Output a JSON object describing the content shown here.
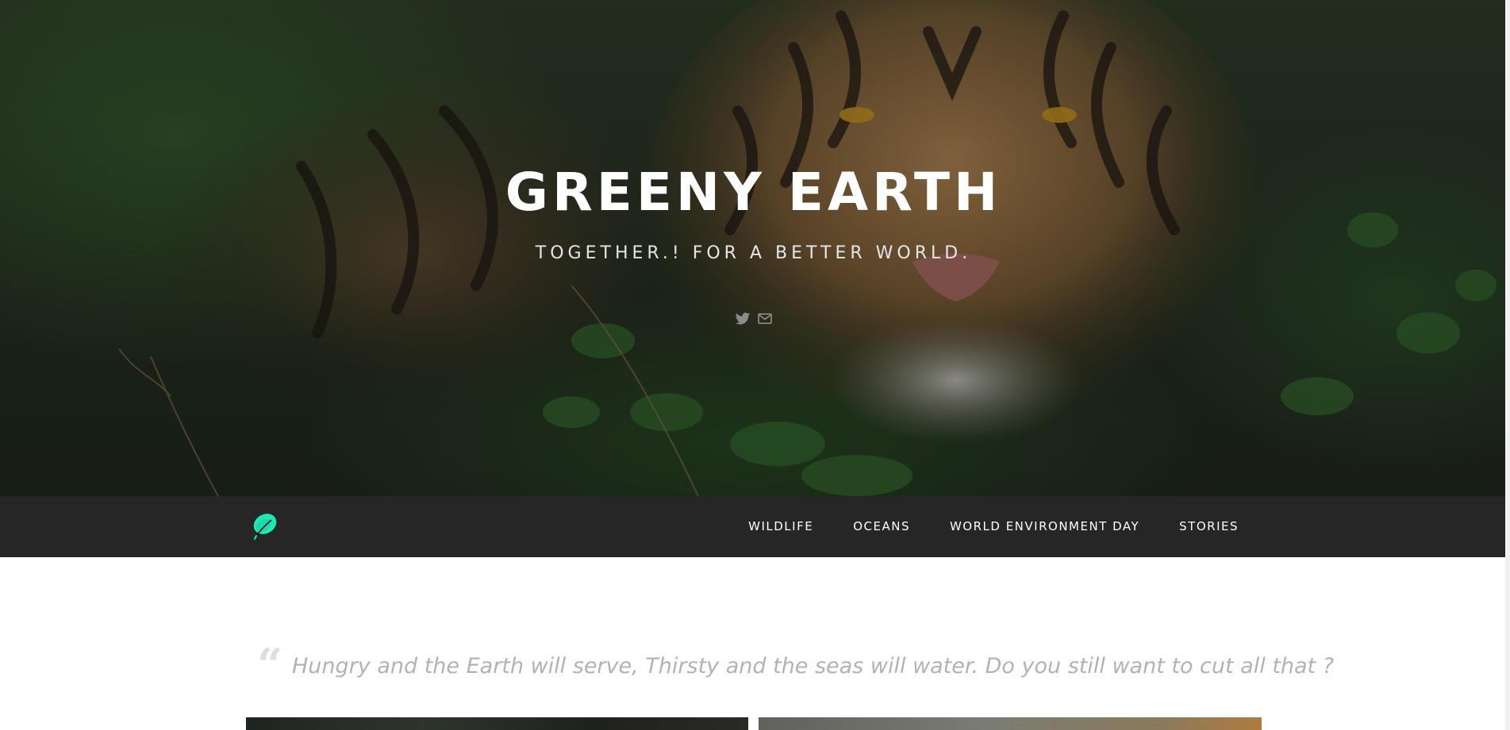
{
  "hero": {
    "title": "GREENY EARTH",
    "subtitle": "TOGETHER.! FOR A BETTER WORLD.",
    "social": [
      {
        "name": "twitter",
        "icon": "twitter-icon"
      },
      {
        "name": "email",
        "icon": "mail-icon"
      }
    ]
  },
  "navbar": {
    "logo_icon": "leaf-logo-icon",
    "logo_color": "#1de9b6",
    "items": [
      {
        "label": "WILDLIFE"
      },
      {
        "label": "OCEANS"
      },
      {
        "label": "WORLD ENVIRONMENT DAY"
      },
      {
        "label": "STORIES"
      }
    ]
  },
  "main": {
    "quote": "Hungry and the Earth will serve, Thirsty and the seas will water. Do you still want to cut all that ?",
    "quote_mark": "“"
  },
  "colors": {
    "navbar_bg": "#262626",
    "quote_text": "#b3b3b3",
    "accent": "#1de9b6"
  }
}
